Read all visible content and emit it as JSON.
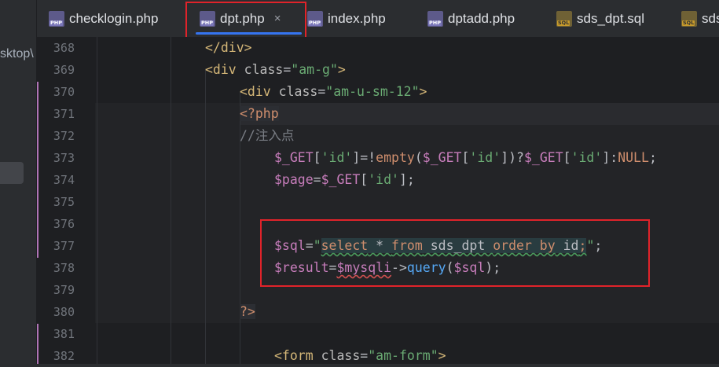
{
  "sidebar": {
    "partial_path_text": "sktop\\"
  },
  "tabs": [
    {
      "label": "checklogin.php",
      "icon": "php-file-icon",
      "icon_text": "PHP",
      "active": false
    },
    {
      "label": "dpt.php",
      "icon": "php-file-icon",
      "icon_text": "PHP",
      "active": true,
      "close": "×"
    },
    {
      "label": "index.php",
      "icon": "php-file-icon",
      "icon_text": "PHP",
      "active": false
    },
    {
      "label": "dptadd.php",
      "icon": "php-file-icon",
      "icon_text": "PHP",
      "active": false
    },
    {
      "label": "sds_dpt.sql",
      "icon": "sql-file-icon",
      "icon_text": "SQL",
      "active": false
    },
    {
      "label": "sds",
      "icon": "sql-file-icon",
      "icon_text": "SQL",
      "active": false
    }
  ],
  "editor": {
    "line_numbers": [
      "368",
      "369",
      "370",
      "371",
      "372",
      "373",
      "374",
      "375",
      "376",
      "377",
      "378",
      "379",
      "380",
      "381",
      "382"
    ],
    "lines": {
      "l368": {
        "a": "</div>"
      },
      "l369": {
        "a": "<div",
        "b": " class",
        "c": "=",
        "d": "\"am-g\"",
        "e": ">"
      },
      "l370": {
        "a": "<div",
        "b": " class",
        "c": "=",
        "d": "\"am-u-sm-12\"",
        "e": ">"
      },
      "l371": {
        "a": "<?php"
      },
      "l372": {
        "a": "//注入点"
      },
      "l373": {
        "a": "$_GET",
        "b": "[",
        "c": "'id'",
        "d": "]=!",
        "e": "empty",
        "f": "(",
        "g": "$_GET",
        "h": "[",
        "i": "'id'",
        "j": "])?",
        "k": "$_GET",
        "l": "[",
        "m": "'id'",
        "n": "]:",
        "o": "NULL",
        "p": ";"
      },
      "l374": {
        "a": "$page",
        "b": "=",
        "c": "$_GET",
        "d": "[",
        "e": "'id'",
        "f": "];"
      },
      "l377": {
        "a": "$sql",
        "b": "=",
        "c": "\"",
        "d": "select",
        "e": " * ",
        "f": "from",
        "g": " sds_dpt ",
        "h": "order by",
        "i": " id",
        "j": ";",
        "k": "\"",
        "l": ";"
      },
      "l378": {
        "a": "$result",
        "b": "=",
        "c": "$mysqli",
        "d": "->",
        "e": "query",
        "f": "(",
        "g": "$sql",
        "h": ");"
      },
      "l380": {
        "a": "?>"
      },
      "l382": {
        "a": "<form",
        "b": " class",
        "c": "=",
        "d": "\"am-form\"",
        "e": ">"
      }
    }
  },
  "colors": {
    "highlight_box": "#e0232a",
    "tab_active_underline": "#3574f0"
  }
}
